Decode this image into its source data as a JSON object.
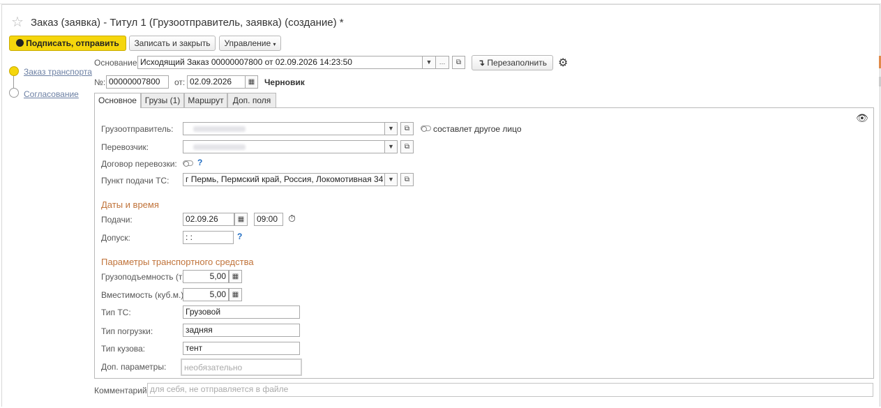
{
  "window": {
    "title": "Заказ (заявка) - Титул 1 (Грузоотправитель, заявка) (создание) *"
  },
  "toolbar": {
    "sign_send": "Подписать, отправить",
    "save_close": "Записать и закрыть",
    "manage": "Управление"
  },
  "steps": [
    {
      "label": "Заказ транспорта",
      "active": true
    },
    {
      "label": "Согласование",
      "active": false
    }
  ],
  "header": {
    "basis_label": "Основание:",
    "basis_value": "Исходящий Заказ 00000007800 от 02.09.2026 14:23:50",
    "refill_label": "Перезаполнить",
    "number_label": "№:",
    "number_value": "00000007800",
    "date_label": "от:",
    "date_value": "02.09.2026",
    "status": "Черновик"
  },
  "tabs": [
    {
      "label": "Основное",
      "active": true
    },
    {
      "label": "Грузы (1)",
      "active": false
    },
    {
      "label": "Маршрут",
      "active": false
    },
    {
      "label": "Доп. поля",
      "active": false
    }
  ],
  "main": {
    "shipper_label": "Грузоотправитель:",
    "other_person_label": "составлет другое лицо",
    "carrier_label": "Перевозчик:",
    "contract_label": "Договор перевозки:",
    "help_mark": "?",
    "pickup_label": "Пункт подачи ТС:",
    "pickup_value": "г Пермь, Пермский край, Россия, Локомотивная 34",
    "dates_section": "Даты и время",
    "supply_label": "Подачи:",
    "supply_date": "02.09.26",
    "supply_time": "09:00",
    "admission_label": "Допуск:",
    "admission_value": " :  : ",
    "vehicle_section": "Параметры транспортного средства",
    "capacity_label": "Грузоподъемность (т):",
    "capacity_value": "5,00",
    "volume_label": "Вместимость (куб.м.):",
    "volume_value": "5,00",
    "vehicle_type_label": "Тип ТС:",
    "vehicle_type_value": "Грузовой",
    "loading_type_label": "Тип погрузки:",
    "loading_type_value": "задняя",
    "body_type_label": "Тип кузова:",
    "body_type_value": "тент",
    "extra_params_label": "Доп. параметры:",
    "extra_params_placeholder": "необязательно"
  },
  "footer": {
    "comment_label": "Комментарий:",
    "comment_placeholder": "для себя, не отправляется в файле"
  },
  "colors": {
    "primary_button": "#f5d60c",
    "section_heading": "#c0733a",
    "step_active": "#f5d60c",
    "link": "#6b7fa3",
    "help": "#1f6cc2"
  }
}
